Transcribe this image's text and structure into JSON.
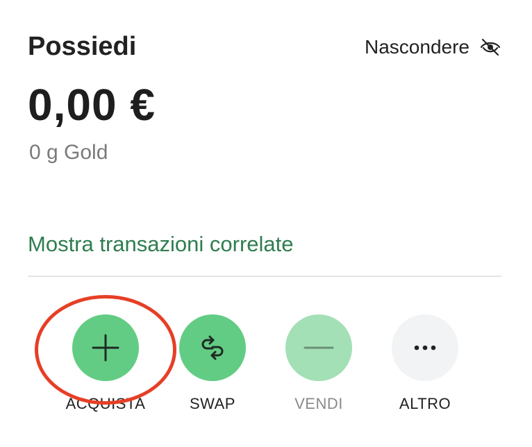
{
  "header": {
    "title": "Possiedi",
    "hide_label": "Nascondere",
    "hide_icon": "eye-off-icon"
  },
  "balance": {
    "amount": "0,00 €",
    "sub_amount": "0 g Gold"
  },
  "links": {
    "transactions_label": "Mostra transazioni correlate"
  },
  "actions": [
    {
      "label": "ACQUISTA",
      "icon": "plus-icon",
      "color": "#63cc84",
      "enabled": true,
      "highlighted": true
    },
    {
      "label": "SWAP",
      "icon": "swap-icon",
      "color": "#63cc84",
      "enabled": true
    },
    {
      "label": "VENDI",
      "icon": "minus-icon",
      "color": "#a3e0b5",
      "enabled": false
    },
    {
      "label": "ALTRO",
      "icon": "more-icon",
      "color": "#f1f3f4",
      "enabled": true
    }
  ],
  "colors": {
    "accent_green": "#2f7d4f",
    "highlight_red": "#e63f26"
  }
}
